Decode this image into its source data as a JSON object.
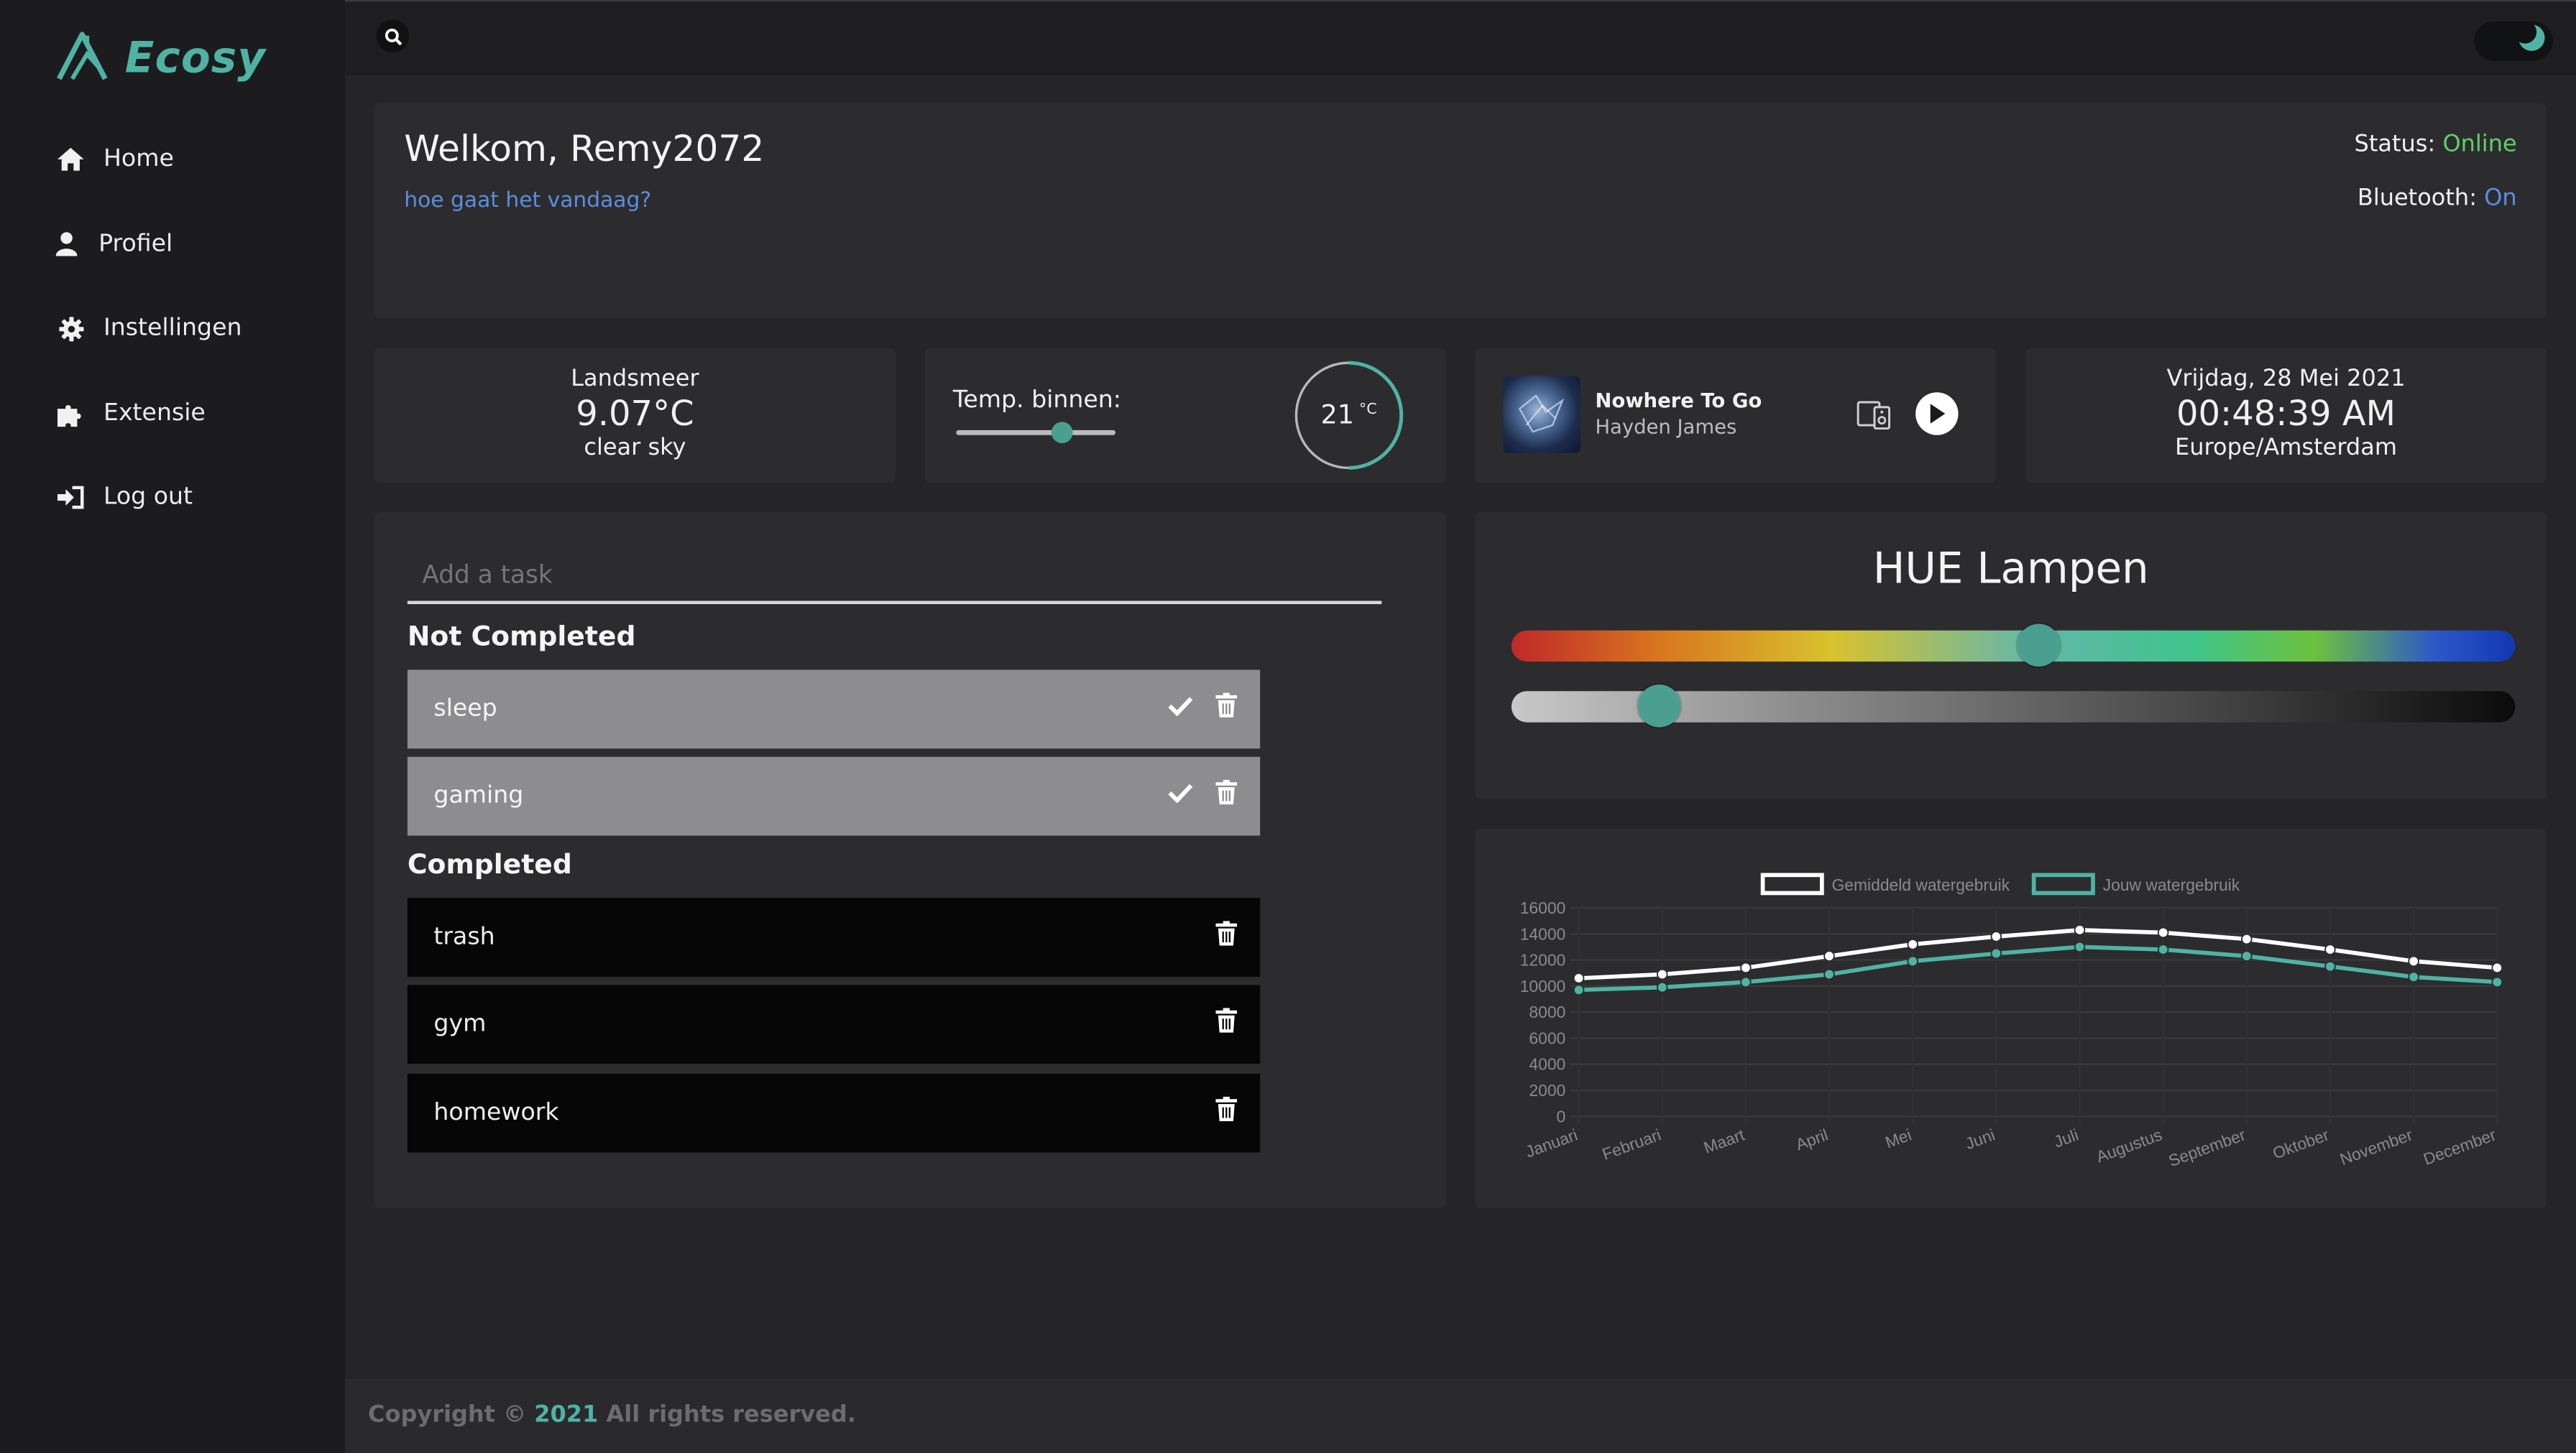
{
  "app": {
    "name": "Ecosy",
    "accent": "#4fb3a4"
  },
  "sidebar": {
    "items": [
      {
        "label": "Home",
        "icon": "home-icon"
      },
      {
        "label": "Profiel",
        "icon": "user-icon"
      },
      {
        "label": "Instellingen",
        "icon": "gear-icon"
      },
      {
        "label": "Extensie",
        "icon": "puzzle-icon"
      },
      {
        "label": "Log out",
        "icon": "logout-icon"
      }
    ]
  },
  "topbar": {
    "search_icon": "search-icon",
    "theme_toggle_icon": "moon-icon"
  },
  "welcome": {
    "title": "Welkom, Remy2072",
    "subtitle": "hoe gaat het vandaag?",
    "status_label": "Status:",
    "status_value": "Online",
    "bluetooth_label": "Bluetooth:",
    "bluetooth_value": "On",
    "status_color": "#5fd068",
    "link_color": "#5a8fe0"
  },
  "weather": {
    "location": "Landsmeer",
    "temp": "9.07°C",
    "description": "clear sky"
  },
  "indoor": {
    "label": "Temp. binnen:",
    "value": "21",
    "unit": "°C",
    "slider_fraction": 0.67
  },
  "music": {
    "title": "Nowhere To Go",
    "artist": "Hayden James",
    "cast_icon": "speaker-icon",
    "play_icon": "play-icon"
  },
  "clock": {
    "date": "Vrijdag, 28 Mei 2021",
    "time": "00:48:39 AM",
    "timezone": "Europe/Amsterdam"
  },
  "tasks": {
    "input_placeholder": "Add a task",
    "not_completed_heading": "Not Completed",
    "completed_heading": "Completed",
    "not_completed": [
      "sleep",
      "gaming"
    ],
    "completed": [
      "trash",
      "gym",
      "homework"
    ]
  },
  "hue": {
    "title": "HUE Lampen",
    "color_fraction": 0.525,
    "brightness_fraction": 0.148
  },
  "chart_data": {
    "type": "line",
    "categories": [
      "Januari",
      "Februari",
      "Maart",
      "April",
      "Mei",
      "Juni",
      "Juli",
      "Augustus",
      "September",
      "Oktober",
      "November",
      "December"
    ],
    "series": [
      {
        "name": "Gemiddeld watergebruik",
        "color": "#ffffff",
        "values": [
          10600,
          10900,
          11400,
          12300,
          13200,
          13800,
          14300,
          14100,
          13600,
          12800,
          11900,
          11400
        ]
      },
      {
        "name": "Jouw watergebruik",
        "color": "#4fb3a4",
        "values": [
          9700,
          9900,
          10300,
          10900,
          11900,
          12500,
          13000,
          12800,
          12300,
          11500,
          10700,
          10300
        ]
      }
    ],
    "ylim": [
      0,
      16000
    ],
    "yticks": [
      "16000",
      "14000",
      "12000",
      "10000",
      "8000",
      "6000",
      "4000",
      "2000",
      "0"
    ],
    "legend": "top",
    "grid": true
  },
  "footer": {
    "prefix": "Copyright ©",
    "year": "2021",
    "suffix": "All rights reserved."
  }
}
